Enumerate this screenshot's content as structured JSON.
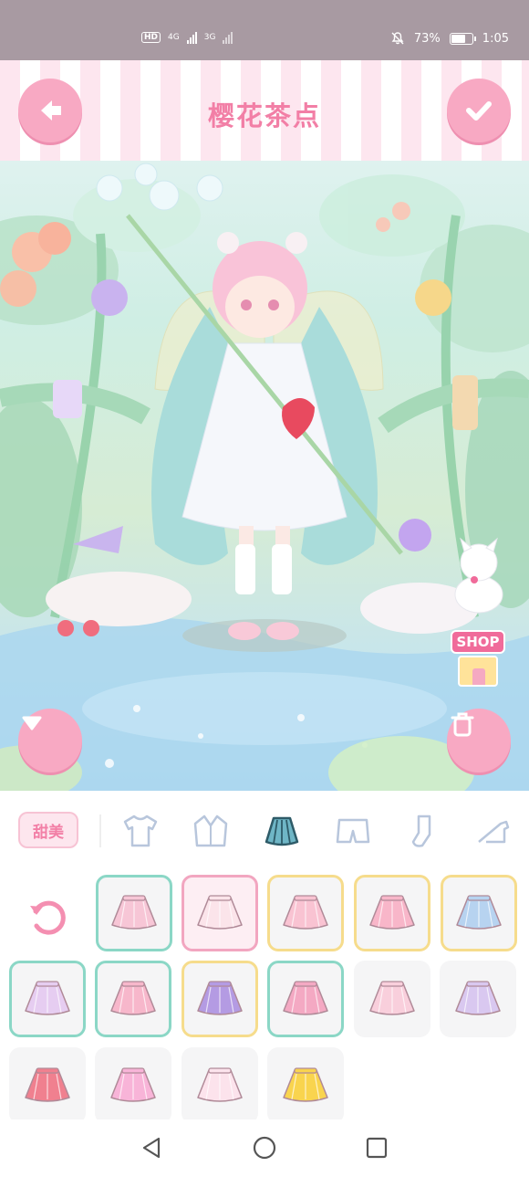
{
  "status_bar": {
    "left_badges": [
      "HD",
      "4G",
      "3G"
    ],
    "battery_percent": "73%",
    "battery_level": 0.73,
    "time": "1:05",
    "icons": [
      "mute-icon",
      "signal-icon",
      "battery-icon"
    ]
  },
  "header": {
    "title": "樱花茶点",
    "back_icon": "arrow-left-icon",
    "confirm_icon": "check-icon"
  },
  "scene": {
    "shop_label": "SHOP",
    "left_button_icon": "triangle-down-icon",
    "right_button_icon": "trash-icon"
  },
  "wardrobe": {
    "style_tab": "甜美",
    "categories": [
      "tshirt-icon",
      "jacket-icon",
      "skirt-icon",
      "shorts-icon",
      "sock-icon",
      "heel-icon"
    ],
    "selected_category": "skirt-icon",
    "reset_icon": "reset-icon",
    "items": [
      {
        "color": "#f7c6d6",
        "border": "green"
      },
      {
        "color": "#fbe4ea",
        "border": "pink",
        "selected": true
      },
      {
        "color": "#f9c3d2",
        "border": "yellow"
      },
      {
        "color": "#f8b6c9",
        "border": "yellow"
      },
      {
        "color": "#b7d3f0",
        "border": "yellow"
      },
      {
        "color": "#e6cdf1",
        "border": "green"
      },
      {
        "color": "#f7b7cb",
        "border": "green"
      },
      {
        "color": "#b49be3",
        "border": "yellow"
      },
      {
        "color": "#f4a9c3",
        "border": "green"
      },
      {
        "color": "#f9cfdc",
        "border": "none"
      },
      {
        "color": "#d9c8f0",
        "border": "none"
      },
      {
        "color": "#f0808f",
        "border": "none"
      },
      {
        "color": "#f8b4d8",
        "border": "none"
      },
      {
        "color": "#fce3ec",
        "border": "none"
      },
      {
        "color": "#f9d44e",
        "border": "none"
      }
    ]
  },
  "nav": {
    "back": "triangle-left-icon",
    "home": "circle-home-icon",
    "recents": "square-recents-icon"
  },
  "colors": {
    "accent_pink": "#f27fa6",
    "button_pink": "#f8a9c3",
    "teal_border": "#8bd7c6",
    "yellow_border": "#f6dc8c"
  }
}
